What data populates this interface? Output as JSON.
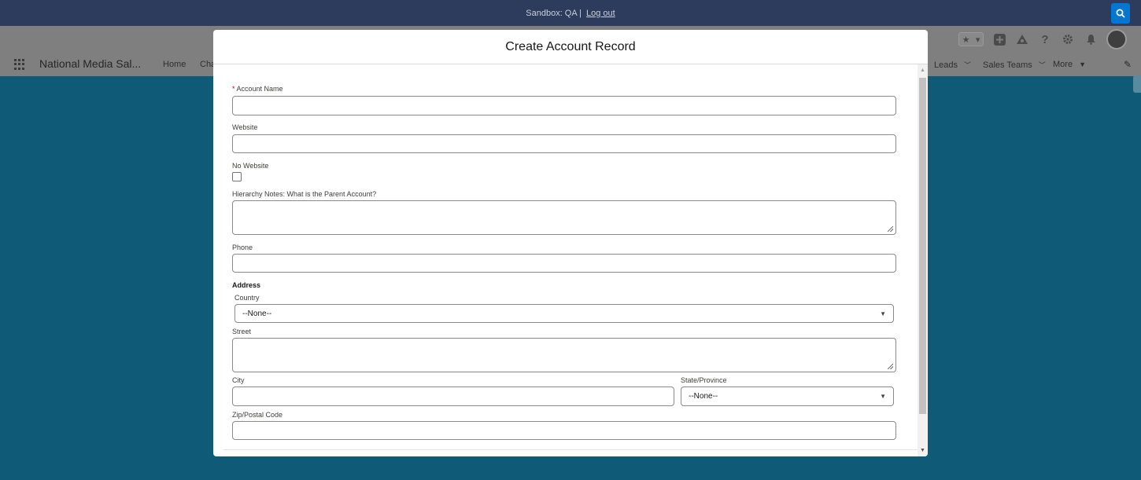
{
  "sandbox": {
    "label": "Sandbox: QA |",
    "logout": "Log out"
  },
  "app": {
    "name": "National Media Sal...",
    "nav": [
      "Home",
      "Chat",
      "Leads",
      "Sales Teams",
      "More"
    ]
  },
  "modal": {
    "title": "Create Account Record",
    "fields": {
      "account_name": {
        "label": "Account Name",
        "value": "",
        "required_marker": "*"
      },
      "website": {
        "label": "Website",
        "value": ""
      },
      "no_website": {
        "label": "No Website",
        "checked": false
      },
      "hierarchy_notes": {
        "label": "Hierarchy Notes: What is the Parent Account?",
        "value": ""
      },
      "phone": {
        "label": "Phone",
        "value": ""
      },
      "address_section": "Address",
      "country": {
        "label": "Country",
        "selected": "--None--"
      },
      "street": {
        "label": "Street",
        "value": ""
      },
      "city": {
        "label": "City",
        "value": ""
      },
      "state": {
        "label": "State/Province",
        "selected": "--None--"
      },
      "zip": {
        "label": "Zip/Postal Code",
        "value": ""
      }
    }
  },
  "colors": {
    "sandbox_bar": "#2d3b5c",
    "backdrop": "#0e5a77",
    "brand_blue": "#0176d3",
    "required": "#ba0517"
  },
  "icons": [
    "search-icon",
    "favorites-star-icon",
    "add-icon",
    "trailhead-icon",
    "help-icon",
    "setup-gear-icon",
    "notifications-bell-icon",
    "app-launcher-icon",
    "edit-pencil-icon"
  ]
}
